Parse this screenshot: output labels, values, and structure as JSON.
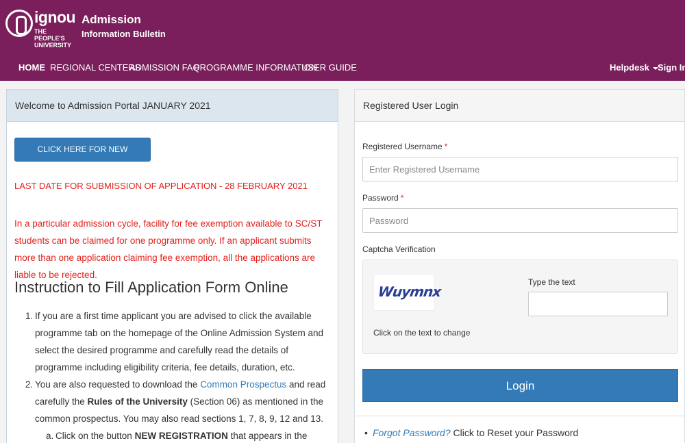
{
  "header": {
    "logo_text": "ignou",
    "logo_sub_1": "THE PEOPLE'S",
    "logo_sub_2": "UNIVERSITY",
    "title": "Admission",
    "subtitle": "Information Bulletin",
    "bg_color": "#7a1f5c"
  },
  "nav": {
    "items": [
      "HOME",
      "REGIONAL CENTERS",
      "ADMISSION FAQ",
      "PROGRAMME INFORMATION",
      "USER GUIDE"
    ],
    "helpdesk": "Helpdesk",
    "signin": "Sign In"
  },
  "left": {
    "heading": "Welcome to Admission Portal JANUARY 2021",
    "register_button": "CLICK HERE FOR NEW REGISTRATION",
    "last_date": "LAST DATE FOR SUBMISSION OF APPLICATION - 28 FEBRUARY 2021",
    "exemption_note": "In a particular admission cycle, facility for fee exemption available to SC/ST students can be claimed for one programme only. If an applicant submits more than one application claiming fee exemption, all the applications are liable to be rejected.",
    "instructions_title": "Instruction to Fill Application Form Online",
    "instructions": {
      "item1_num": "1.",
      "item1": "If you are a first time applicant you are advised to click the available programme tab on the homepage of the Online Admission System and select the desired programme and carefully read the details of programme including eligibility criteria, fee details, duration, etc.",
      "item2_num": "2.",
      "item2_a": "You are also requested to download the ",
      "item2_link": "Common Prospectus",
      "item2_b": " and read carefully the ",
      "item2_bold": "Rules of the University",
      "item2_c": " (Section 06) as mentioned in the common prospectus. You may also read sections 1, 7, 8, 9, 12 and 13.",
      "sub_a_num": "a.",
      "sub_a_1": "Click on the button ",
      "sub_a_bold": "NEW REGISTRATION",
      "sub_a_2": " that appears in the applicant login"
    }
  },
  "login": {
    "heading": "Registered User Login",
    "username_label": "Registered Username",
    "username_placeholder": "Enter Registered Username",
    "password_label": "Password",
    "password_placeholder": "Password",
    "required_mark": "*",
    "captcha_label": "Captcha Verification",
    "captcha_text": "Wuymnx",
    "captcha_hint": "Click on the text to change",
    "type_text_label": "Type the text",
    "login_button": "Login",
    "forgot_link": "Forgot Password?",
    "forgot_text": " Click to Reset your Password",
    "bullet": "•"
  }
}
